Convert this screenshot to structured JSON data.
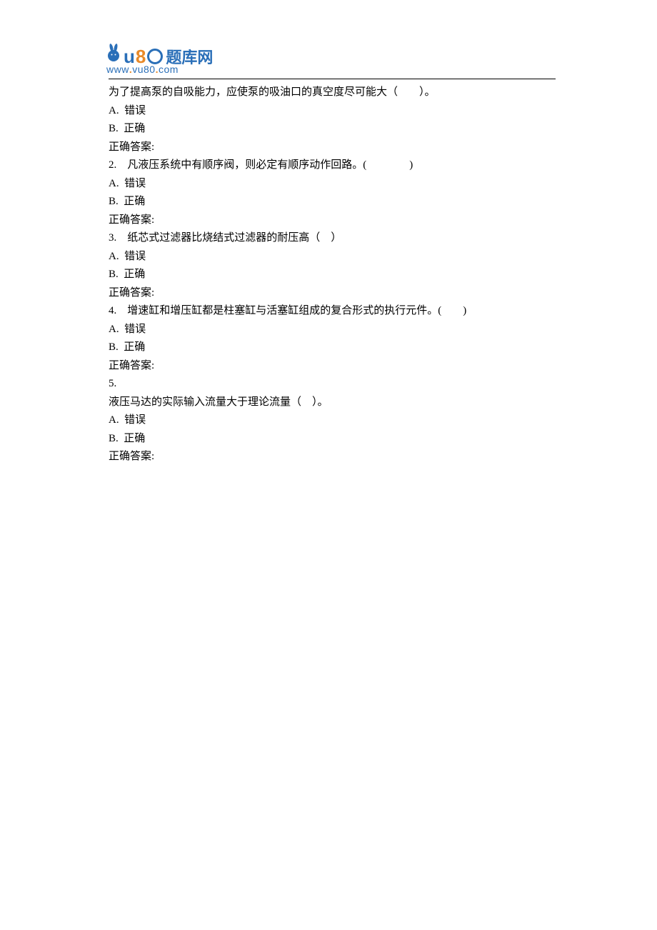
{
  "logo": {
    "cn_text": "题库网",
    "url_part1": "www",
    "url_part2": "vu80",
    "url_part3": "com"
  },
  "q1": {
    "text": "为了提高泵的自吸能力，应使泵的吸油口的真空度尽可能大（        ）。",
    "optA": "A.  错误",
    "optB": "B.  正确",
    "ans": "正确答案:"
  },
  "q2": {
    "text": "2.    凡液压系统中有顺序阀，则必定有顺序动作回路。(                )",
    "optA": "A.  错误",
    "optB": "B.  正确",
    "ans": "正确答案:"
  },
  "q3": {
    "text": "3.    纸芯式过滤器比烧结式过滤器的耐压高（    ）",
    "optA": "A.  错误",
    "optB": "B.  正确",
    "ans": "正确答案:"
  },
  "q4": {
    "text": "4.    增速缸和增压缸都是柱塞缸与活塞缸组成的复合形式的执行元件。(        )",
    "optA": "A.  错误",
    "optB": "B.  正确",
    "ans": "正确答案:"
  },
  "q5": {
    "num": "5.",
    "text": "液压马达的实际输入流量大于理论流量（    ）。",
    "optA": "A.  错误",
    "optB": "B.  正确",
    "ans": "正确答案:"
  }
}
